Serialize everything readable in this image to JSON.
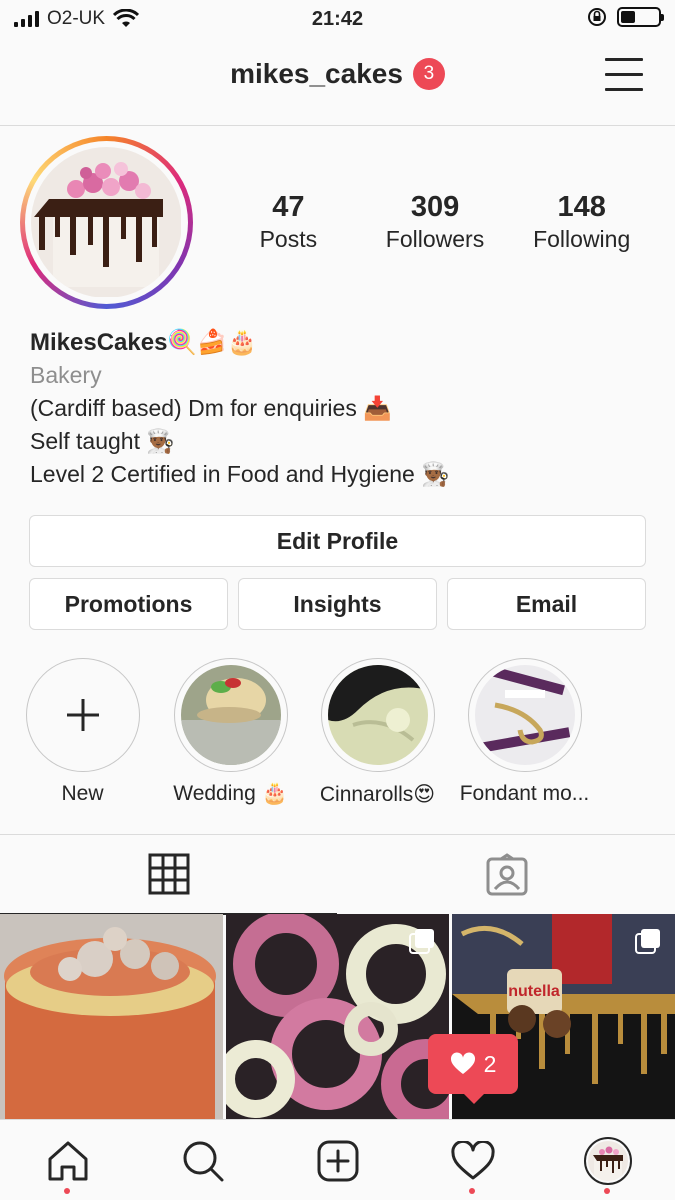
{
  "status_bar": {
    "carrier": "O2-UK",
    "time": "21:42"
  },
  "header": {
    "username": "mikes_cakes",
    "notification_count": "3",
    "notification_color": "#ed4956"
  },
  "profile": {
    "stats": [
      {
        "number": "47",
        "label": "Posts"
      },
      {
        "number": "309",
        "label": "Followers"
      },
      {
        "number": "148",
        "label": "Following"
      }
    ],
    "name": "MikesCakes🍭🍰🎂",
    "category": "Bakery",
    "bio_lines": [
      "(Cardiff based) Dm for enquiries 📥",
      "Self taught 👨🏾‍🍳",
      "Level 2 Certified in Food and Hygiene 👨🏾‍🍳"
    ]
  },
  "buttons": {
    "edit_profile": "Edit Profile",
    "promotions": "Promotions",
    "insights": "Insights",
    "email": "Email"
  },
  "highlights": [
    {
      "label": "New",
      "icon": "plus-icon"
    },
    {
      "label": "Wedding 🎂"
    },
    {
      "label": "Cinnarolls😍"
    },
    {
      "label": "Fondant mo..."
    }
  ],
  "tabs": [
    {
      "icon": "grid-icon",
      "active": true
    },
    {
      "icon": "tagged-icon",
      "active": false
    }
  ],
  "activity": {
    "like_count": "2"
  },
  "bottom_nav": [
    {
      "icon": "home-icon",
      "dot": true
    },
    {
      "icon": "search-icon",
      "dot": false
    },
    {
      "icon": "add-post-icon",
      "dot": false
    },
    {
      "icon": "heart-icon",
      "dot": true
    },
    {
      "icon": "profile-avatar-icon",
      "dot": true
    }
  ],
  "colors": {
    "accent_red": "#ed4956",
    "text": "#262626",
    "muted": "#8e8e8e",
    "border": "#dbdbdb"
  }
}
